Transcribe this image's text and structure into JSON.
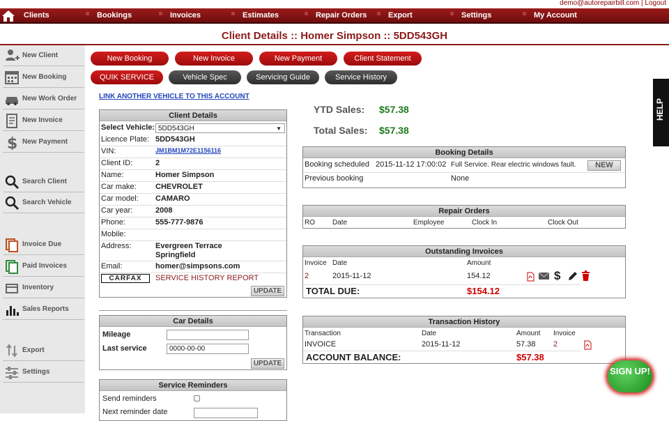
{
  "header": {
    "user_email": "demo@autorepairbill.com",
    "separator": "|",
    "logout": "Logout"
  },
  "nav": {
    "items": [
      "Clients",
      "Bookings",
      "Invoices",
      "Estimates",
      "Repair Orders",
      "Export",
      "Settings",
      "My Account"
    ]
  },
  "page_title": "Client Details :: Homer Simpson :: 5DD543GH",
  "sidebar": {
    "items": [
      {
        "label": "New Client",
        "icon": "add-user-icon"
      },
      {
        "label": "New Booking",
        "icon": "calendar-icon"
      },
      {
        "label": "New Work Order",
        "icon": "car-icon"
      },
      {
        "label": "New Invoice",
        "icon": "invoice-icon"
      },
      {
        "label": "New Payment",
        "icon": "dollar-icon"
      },
      {
        "label": "Search Client",
        "icon": "search-icon"
      },
      {
        "label": "Search Vehicle",
        "icon": "search-icon"
      },
      {
        "label": "Invoice Due",
        "icon": "copy-icon"
      },
      {
        "label": "Paid Invoices",
        "icon": "copy-icon"
      },
      {
        "label": "Inventory",
        "icon": "box-icon"
      },
      {
        "label": "Sales Reports",
        "icon": "bar-chart-icon"
      },
      {
        "label": "Export",
        "icon": "export-icon"
      },
      {
        "label": "Settings",
        "icon": "sliders-icon"
      }
    ]
  },
  "actions": {
    "row1": [
      "New Booking",
      "New Invoice",
      "New Payment",
      "Client Statement"
    ],
    "row2": [
      "QUIK SERVICE",
      "Vehicle Spec",
      "Servicing Guide",
      "Service History"
    ]
  },
  "link_vehicle": "LINK ANOTHER VEHICLE TO THIS ACCOUNT",
  "client_details": {
    "title": "Client Details",
    "select_vehicle_label": "Select Vehicle:",
    "select_vehicle_value": "5DD543GH",
    "rows": [
      {
        "label": "Licence Plate:",
        "value": "5DD543GH"
      },
      {
        "label": "VIN:",
        "value": "JM1BM1M72E1156116"
      },
      {
        "label": "Client ID:",
        "value": "2"
      },
      {
        "label": "Name:",
        "value": "Homer Simpson"
      },
      {
        "label": "Car make:",
        "value": "CHEVROLET"
      },
      {
        "label": "Car model:",
        "value": "CAMARO"
      },
      {
        "label": "Car year:",
        "value": "2008"
      },
      {
        "label": "Phone:",
        "value": "555-777-9876"
      },
      {
        "label": "Mobile:",
        "value": ""
      }
    ],
    "address_label": "Address:",
    "address_line1": "Evergreen Terrace",
    "address_line2": "Springfield",
    "email_label": "Email:",
    "email_value": "homer@simpsons.com",
    "carfax": "CARFAX",
    "service_history_report": "SERVICE HISTORY REPORT",
    "update": "UPDATE"
  },
  "car_details": {
    "title": "Car Details",
    "mileage_label": "Mileage",
    "mileage_value": "",
    "last_service_label": "Last service",
    "last_service_value": "0000-00-00",
    "update": "UPDATE"
  },
  "service_reminders": {
    "title": "Service Reminders",
    "send_label": "Send reminders",
    "next_label": "Next reminder date"
  },
  "sales": {
    "ytd_label": "YTD Sales:",
    "ytd_value": "$57.38",
    "total_label": "Total Sales:",
    "total_value": "$57.38"
  },
  "booking_details": {
    "title": "Booking Details",
    "scheduled_label": "Booking scheduled",
    "scheduled_date": "2015-11-12 17:00:02",
    "scheduled_desc": "Full Service. Rear electric windows fault.",
    "new_button": "NEW",
    "previous_label": "Previous booking",
    "previous_value": "None"
  },
  "repair_orders": {
    "title": "Repair Orders",
    "columns": [
      "RO",
      "Date",
      "Employee",
      "Clock In",
      "Clock Out"
    ]
  },
  "outstanding_invoices": {
    "title": "Outstanding Invoices",
    "columns": [
      "Invoice",
      "Date",
      "Amount"
    ],
    "rows": [
      {
        "invoice": "2",
        "date": "2015-11-12",
        "amount": "154.12"
      }
    ],
    "total_label": "TOTAL DUE:",
    "total_value": "$154.12"
  },
  "transaction_history": {
    "title": "Transaction History",
    "columns": [
      "Transaction",
      "Date",
      "Amount",
      "Invoice"
    ],
    "rows": [
      {
        "transaction": "INVOICE",
        "date": "2015-11-12",
        "amount": "57.38",
        "invoice": "2"
      }
    ],
    "balance_label": "ACCOUNT BALANCE:",
    "balance_value": "$57.38"
  },
  "help_tab": "HELP",
  "signup": "SIGN UP!",
  "colors": {
    "brand_red": "#8b1a1a",
    "nav_red": "#9b1b1b",
    "money_green": "#1f7a1f",
    "alert_red": "#d00000"
  }
}
